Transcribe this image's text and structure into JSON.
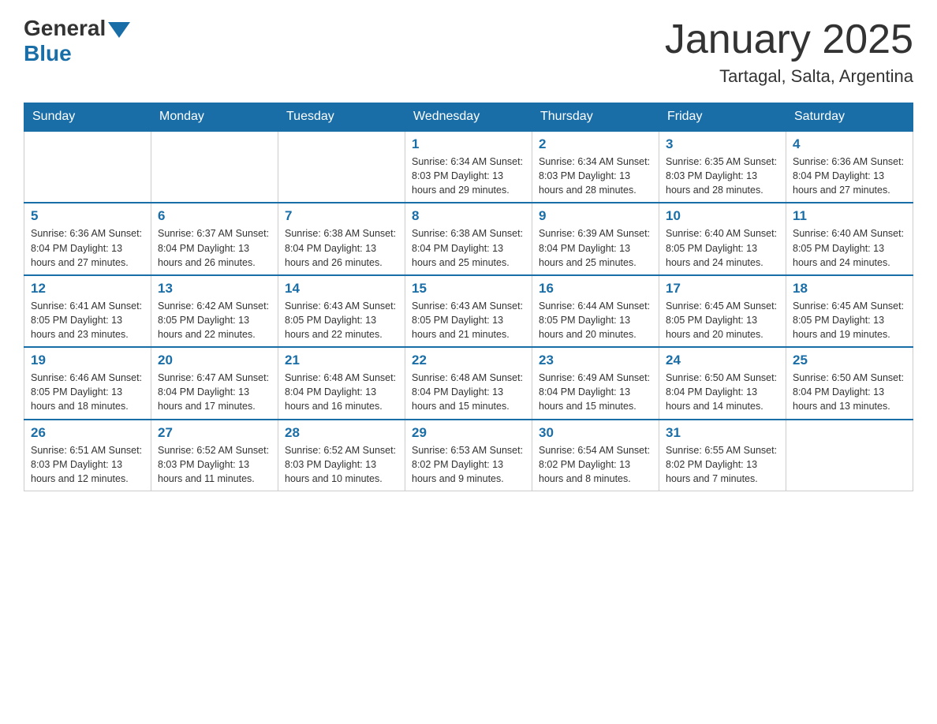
{
  "header": {
    "logo_general": "General",
    "logo_blue": "Blue",
    "month_title": "January 2025",
    "location": "Tartagal, Salta, Argentina"
  },
  "days_of_week": [
    "Sunday",
    "Monday",
    "Tuesday",
    "Wednesday",
    "Thursday",
    "Friday",
    "Saturday"
  ],
  "weeks": [
    [
      {
        "day": "",
        "info": ""
      },
      {
        "day": "",
        "info": ""
      },
      {
        "day": "",
        "info": ""
      },
      {
        "day": "1",
        "info": "Sunrise: 6:34 AM\nSunset: 8:03 PM\nDaylight: 13 hours and 29 minutes."
      },
      {
        "day": "2",
        "info": "Sunrise: 6:34 AM\nSunset: 8:03 PM\nDaylight: 13 hours and 28 minutes."
      },
      {
        "day": "3",
        "info": "Sunrise: 6:35 AM\nSunset: 8:03 PM\nDaylight: 13 hours and 28 minutes."
      },
      {
        "day": "4",
        "info": "Sunrise: 6:36 AM\nSunset: 8:04 PM\nDaylight: 13 hours and 27 minutes."
      }
    ],
    [
      {
        "day": "5",
        "info": "Sunrise: 6:36 AM\nSunset: 8:04 PM\nDaylight: 13 hours and 27 minutes."
      },
      {
        "day": "6",
        "info": "Sunrise: 6:37 AM\nSunset: 8:04 PM\nDaylight: 13 hours and 26 minutes."
      },
      {
        "day": "7",
        "info": "Sunrise: 6:38 AM\nSunset: 8:04 PM\nDaylight: 13 hours and 26 minutes."
      },
      {
        "day": "8",
        "info": "Sunrise: 6:38 AM\nSunset: 8:04 PM\nDaylight: 13 hours and 25 minutes."
      },
      {
        "day": "9",
        "info": "Sunrise: 6:39 AM\nSunset: 8:04 PM\nDaylight: 13 hours and 25 minutes."
      },
      {
        "day": "10",
        "info": "Sunrise: 6:40 AM\nSunset: 8:05 PM\nDaylight: 13 hours and 24 minutes."
      },
      {
        "day": "11",
        "info": "Sunrise: 6:40 AM\nSunset: 8:05 PM\nDaylight: 13 hours and 24 minutes."
      }
    ],
    [
      {
        "day": "12",
        "info": "Sunrise: 6:41 AM\nSunset: 8:05 PM\nDaylight: 13 hours and 23 minutes."
      },
      {
        "day": "13",
        "info": "Sunrise: 6:42 AM\nSunset: 8:05 PM\nDaylight: 13 hours and 22 minutes."
      },
      {
        "day": "14",
        "info": "Sunrise: 6:43 AM\nSunset: 8:05 PM\nDaylight: 13 hours and 22 minutes."
      },
      {
        "day": "15",
        "info": "Sunrise: 6:43 AM\nSunset: 8:05 PM\nDaylight: 13 hours and 21 minutes."
      },
      {
        "day": "16",
        "info": "Sunrise: 6:44 AM\nSunset: 8:05 PM\nDaylight: 13 hours and 20 minutes."
      },
      {
        "day": "17",
        "info": "Sunrise: 6:45 AM\nSunset: 8:05 PM\nDaylight: 13 hours and 20 minutes."
      },
      {
        "day": "18",
        "info": "Sunrise: 6:45 AM\nSunset: 8:05 PM\nDaylight: 13 hours and 19 minutes."
      }
    ],
    [
      {
        "day": "19",
        "info": "Sunrise: 6:46 AM\nSunset: 8:05 PM\nDaylight: 13 hours and 18 minutes."
      },
      {
        "day": "20",
        "info": "Sunrise: 6:47 AM\nSunset: 8:04 PM\nDaylight: 13 hours and 17 minutes."
      },
      {
        "day": "21",
        "info": "Sunrise: 6:48 AM\nSunset: 8:04 PM\nDaylight: 13 hours and 16 minutes."
      },
      {
        "day": "22",
        "info": "Sunrise: 6:48 AM\nSunset: 8:04 PM\nDaylight: 13 hours and 15 minutes."
      },
      {
        "day": "23",
        "info": "Sunrise: 6:49 AM\nSunset: 8:04 PM\nDaylight: 13 hours and 15 minutes."
      },
      {
        "day": "24",
        "info": "Sunrise: 6:50 AM\nSunset: 8:04 PM\nDaylight: 13 hours and 14 minutes."
      },
      {
        "day": "25",
        "info": "Sunrise: 6:50 AM\nSunset: 8:04 PM\nDaylight: 13 hours and 13 minutes."
      }
    ],
    [
      {
        "day": "26",
        "info": "Sunrise: 6:51 AM\nSunset: 8:03 PM\nDaylight: 13 hours and 12 minutes."
      },
      {
        "day": "27",
        "info": "Sunrise: 6:52 AM\nSunset: 8:03 PM\nDaylight: 13 hours and 11 minutes."
      },
      {
        "day": "28",
        "info": "Sunrise: 6:52 AM\nSunset: 8:03 PM\nDaylight: 13 hours and 10 minutes."
      },
      {
        "day": "29",
        "info": "Sunrise: 6:53 AM\nSunset: 8:02 PM\nDaylight: 13 hours and 9 minutes."
      },
      {
        "day": "30",
        "info": "Sunrise: 6:54 AM\nSunset: 8:02 PM\nDaylight: 13 hours and 8 minutes."
      },
      {
        "day": "31",
        "info": "Sunrise: 6:55 AM\nSunset: 8:02 PM\nDaylight: 13 hours and 7 minutes."
      },
      {
        "day": "",
        "info": ""
      }
    ]
  ]
}
